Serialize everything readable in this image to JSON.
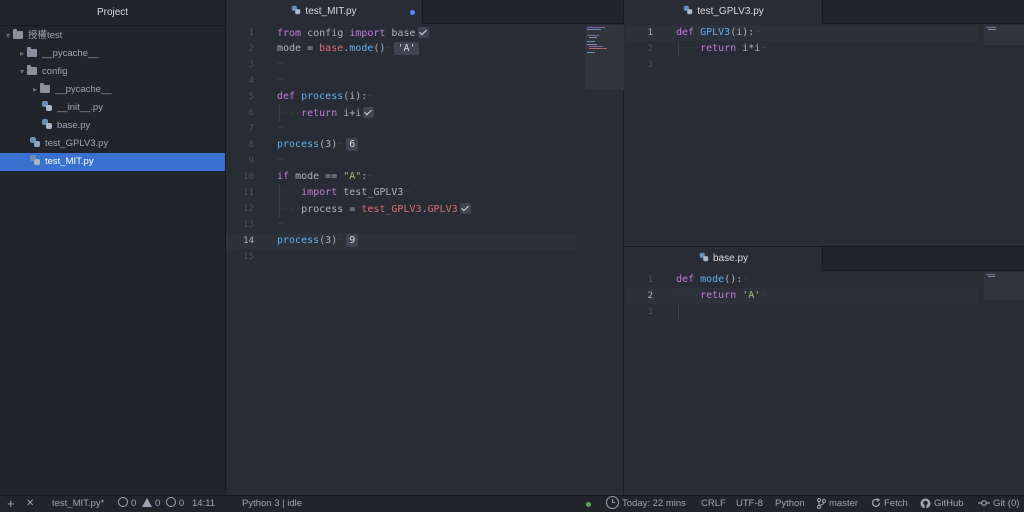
{
  "sidebar": {
    "title": "Project",
    "tree": [
      {
        "label": "授權test",
        "type": "folder",
        "expanded": true
      },
      {
        "label": "__pycache__",
        "type": "folder",
        "expanded": false
      },
      {
        "label": "config",
        "type": "folder",
        "expanded": true
      },
      {
        "label": "__pycache__",
        "type": "folder",
        "expanded": false
      },
      {
        "label": "__init__.py",
        "type": "python-file"
      },
      {
        "label": "base.py",
        "type": "python-file"
      },
      {
        "label": "test_GPLV3.py",
        "type": "python-file-modified"
      },
      {
        "label": "test_MIT.py",
        "type": "python-file",
        "selected": true
      }
    ]
  },
  "left_pane": {
    "tab": {
      "label": "test_MIT.py",
      "modified": true
    },
    "cursor_line": 14,
    "line_numbers": [
      "1",
      "2",
      "3",
      "4",
      "5",
      "6",
      "7",
      "8",
      "9",
      "10",
      "11",
      "12",
      "13",
      "14",
      "15"
    ],
    "inline_results": {
      "line2": "'A'",
      "line8": "6",
      "line14": "9"
    }
  },
  "right_top_pane": {
    "tab": {
      "label": "test_GPLV3.py"
    },
    "line_numbers": [
      "1",
      "2",
      "3"
    ]
  },
  "right_bottom_pane": {
    "tab": {
      "label": "base.py"
    },
    "line_numbers": [
      "1",
      "2",
      "3"
    ]
  },
  "statusbar": {
    "add": "+",
    "close": "✕",
    "file": "test_MIT.py*",
    "errors": "0",
    "warnings": "0",
    "infos": "0",
    "cursor_pos": "14:11",
    "kernel": "Python 3 | idle",
    "time_tracker": "Today: 22 mins",
    "line_ending": "CRLF",
    "encoding": "UTF-8",
    "grammar": "Python",
    "branch": "master",
    "fetch": "Fetch",
    "github": "GitHub",
    "git": "Git (0)"
  },
  "colors": {
    "accent": "#568af2",
    "selection": "#3a70cf",
    "editor_bg": "#282c34",
    "panel_bg": "#21252b",
    "keyword": "#c678dd",
    "function": "#61afef",
    "string": "#98c379",
    "variable": "#e06c75"
  }
}
